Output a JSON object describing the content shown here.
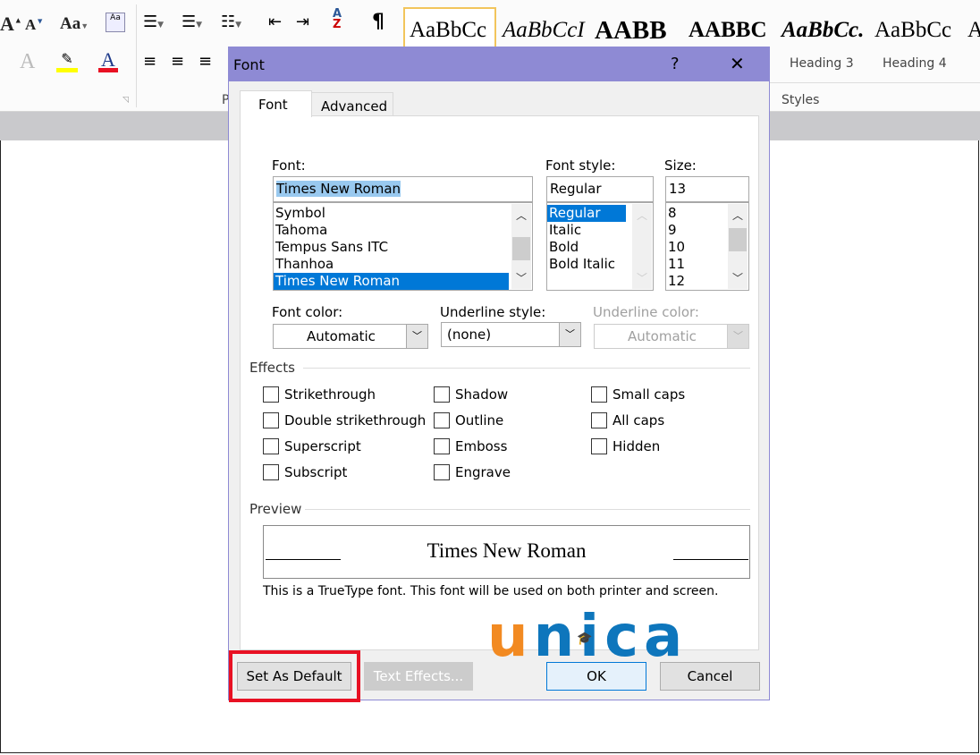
{
  "ribbon": {
    "styles_gallery": [
      "AaBbCc",
      "AaBbCcI",
      "AABB",
      "AABBC",
      "AaBbCc.",
      "AaBbCc",
      "A"
    ],
    "style_names": [
      "Heading 3",
      "Heading 4"
    ],
    "group_styles": "Styles",
    "group_paragraph_partial": "P",
    "pilcrow": "¶",
    "font_color": "#e81123",
    "highlight_color": "#ffff00"
  },
  "dialog": {
    "title": "Font",
    "help": "?",
    "close": "✕",
    "tabs": [
      {
        "label": "Font",
        "active": true
      },
      {
        "label": "Advanced",
        "active": false
      }
    ],
    "font_label": "Font:",
    "font_value": "Times New Roman",
    "font_list": [
      "Symbol",
      "Tahoma",
      "Tempus Sans ITC",
      "Thanhoa",
      "Times New Roman"
    ],
    "font_selected": "Times New Roman",
    "style_label": "Font style:",
    "style_value": "Regular",
    "style_list": [
      "Regular",
      "Italic",
      "Bold",
      "Bold Italic"
    ],
    "size_label": "Size:",
    "size_value": "13",
    "size_list": [
      "8",
      "9",
      "10",
      "11",
      "12"
    ],
    "font_color_label": "Font color:",
    "font_color_value": "Automatic",
    "underline_style_label": "Underline style:",
    "underline_style_value": "(none)",
    "underline_color_label": "Underline color:",
    "underline_color_value": "Automatic",
    "effects_label": "Effects",
    "effects": [
      [
        "Strikethrough",
        "Double strikethrough",
        "Superscript",
        "Subscript"
      ],
      [
        "Shadow",
        "Outline",
        "Emboss",
        "Engrave"
      ],
      [
        "Small caps",
        "All caps",
        "Hidden"
      ]
    ],
    "preview_label": "Preview",
    "preview_text": "Times New Roman",
    "info": "This is a TrueType font. This font will be used on both printer and screen.",
    "buttons": {
      "set_default": "Set As Default",
      "text_effects": "Text Effects...",
      "ok": "OK",
      "cancel": "Cancel"
    },
    "highlight_color": "#e81123"
  },
  "watermark": {
    "text": "unica",
    "u_color": "#f28a22",
    "rest_color": "#0e76bc"
  }
}
